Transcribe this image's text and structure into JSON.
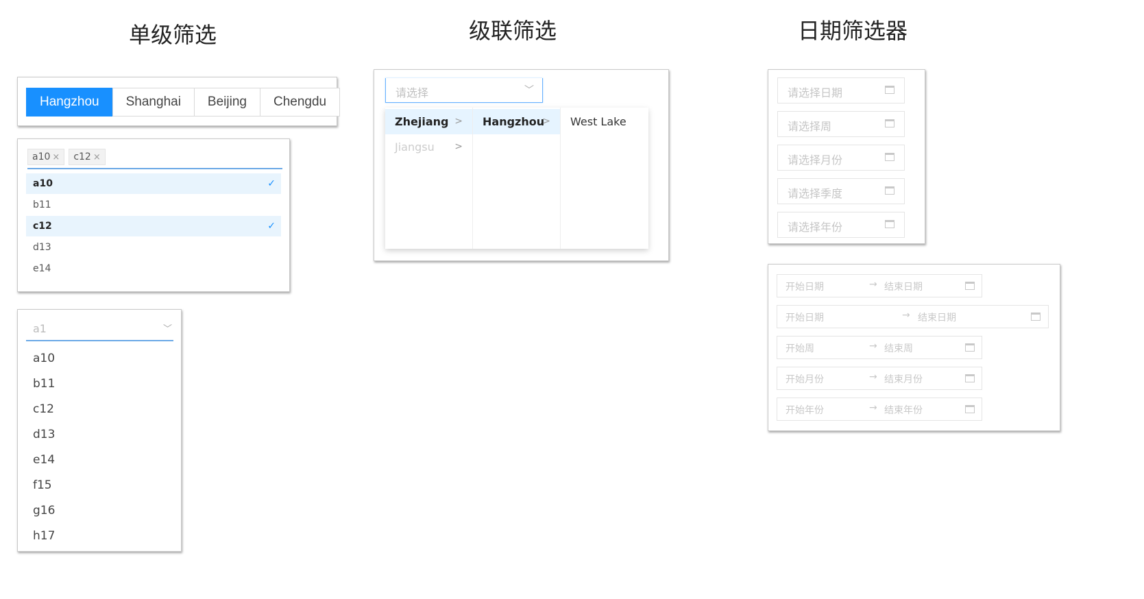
{
  "titles": {
    "single": "单级筛选",
    "cascade": "级联筛选",
    "date": "日期筛选器"
  },
  "radio": {
    "options": [
      "Hangzhou",
      "Shanghai",
      "Beijing",
      "Chengdu"
    ],
    "selected": "Hangzhou"
  },
  "multi": {
    "tags": [
      "a10",
      "c12"
    ],
    "options": [
      {
        "label": "a10",
        "selected": true
      },
      {
        "label": "b11",
        "selected": false
      },
      {
        "label": "c12",
        "selected": true
      },
      {
        "label": "d13",
        "selected": false
      },
      {
        "label": "e14",
        "selected": false
      }
    ],
    "check": "✓",
    "remove": "×"
  },
  "single_select": {
    "placeholder": "a1",
    "arrow": "﹀",
    "items": [
      "a10",
      "b11",
      "c12",
      "d13",
      "e14",
      "f15",
      "g16",
      "h17"
    ]
  },
  "cascader": {
    "placeholder": "请选择",
    "arrow": "﹀",
    "chevron": ">",
    "col1": [
      {
        "label": "Zhejiang",
        "active": true,
        "dim": false
      },
      {
        "label": "Jiangsu",
        "active": false,
        "dim": true
      }
    ],
    "col2": [
      {
        "label": "Hangzhou",
        "active": true
      }
    ],
    "col3": [
      {
        "label": "West Lake",
        "active": false
      }
    ]
  },
  "date_pickers": [
    "请选择日期",
    "请选择周",
    "请选择月份",
    "请选择季度",
    "请选择年份"
  ],
  "range_pickers": [
    {
      "start": "开始日期",
      "end": "结束日期"
    },
    {
      "start": "开始日期",
      "end": "结束日期"
    },
    {
      "start": "开始周",
      "end": "结束周"
    },
    {
      "start": "开始月份",
      "end": "结束月份"
    },
    {
      "start": "开始年份",
      "end": "结束年份"
    }
  ],
  "range_arrow": "→",
  "colors": {
    "accent": "#1890ff",
    "selected_bg": "#e8f4fd"
  }
}
